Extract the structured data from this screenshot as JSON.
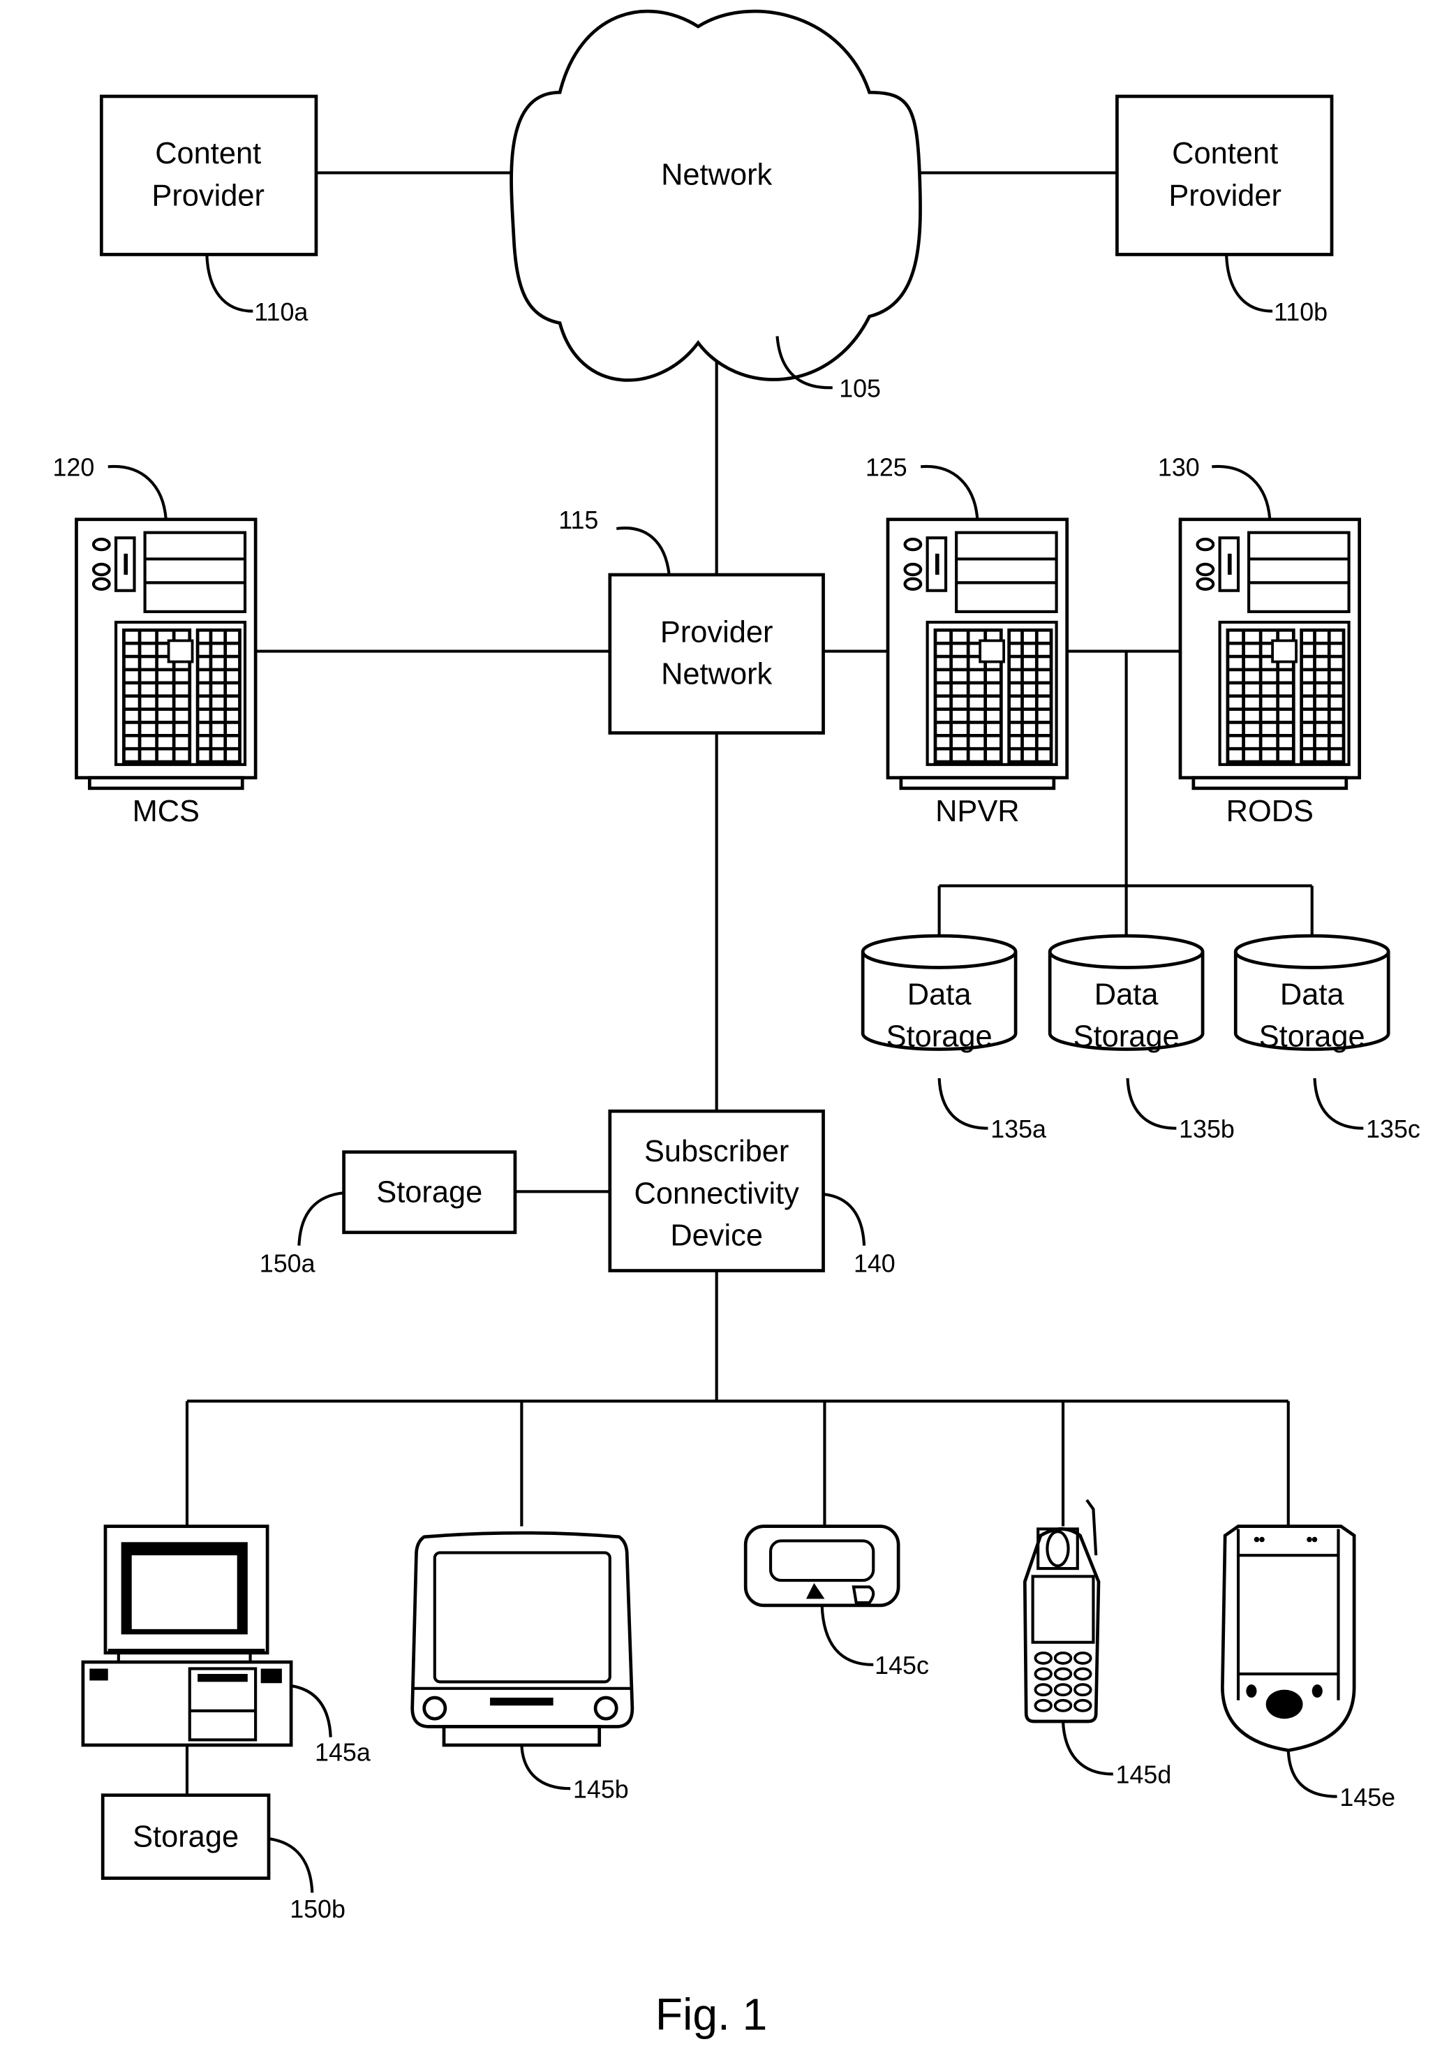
{
  "figure_caption": "Fig. 1",
  "nodes": {
    "network": {
      "label": "Network",
      "ref": "105"
    },
    "content_provider_a": {
      "line1": "Content",
      "line2": "Provider",
      "ref": "110a"
    },
    "content_provider_b": {
      "line1": "Content",
      "line2": "Provider",
      "ref": "110b"
    },
    "provider_network": {
      "line1": "Provider",
      "line2": "Network",
      "ref": "115"
    },
    "mcs": {
      "label": "MCS",
      "ref": "120"
    },
    "npvr": {
      "label": "NPVR",
      "ref": "125"
    },
    "rods": {
      "label": "RODS",
      "ref": "130"
    },
    "data_storage_a": {
      "line1": "Data",
      "line2": "Storage",
      "ref": "135a"
    },
    "data_storage_b": {
      "line1": "Data",
      "line2": "Storage",
      "ref": "135b"
    },
    "data_storage_c": {
      "line1": "Data",
      "line2": "Storage",
      "ref": "135c"
    },
    "subscriber_device": {
      "line1": "Subscriber",
      "line2": "Connectivity",
      "line3": "Device",
      "ref": "140"
    },
    "storage_a": {
      "label": "Storage",
      "ref": "150a"
    },
    "storage_b": {
      "label": "Storage",
      "ref": "150b"
    },
    "computer": {
      "ref": "145a"
    },
    "television": {
      "ref": "145b"
    },
    "pager": {
      "ref": "145c"
    },
    "cell_phone": {
      "ref": "145d"
    },
    "pda": {
      "ref": "145e"
    }
  }
}
